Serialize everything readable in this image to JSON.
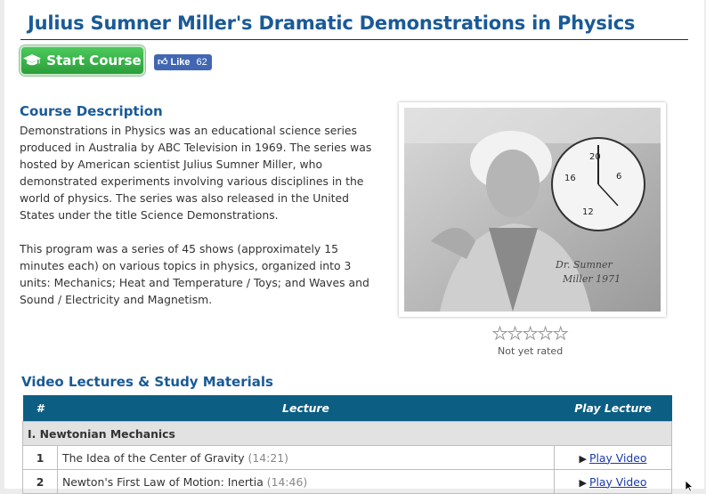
{
  "course": {
    "title": "Julius Sumner Miller's Dramatic Demonstrations in Physics",
    "start_label": "Start Course",
    "fb_like_label": "Like",
    "fb_like_count": "62"
  },
  "description": {
    "heading": "Course Description",
    "paragraphs": [
      "Demonstrations in Physics was an educational science series produced in Australia by ABC Television in 1969. The series was hosted by American scientist Julius Sumner Miller, who demonstrated experiments involving various disciplines in the world of physics. The series was also released in the United States under the title Science Demonstrations.",
      "This program was a series of 45 shows (approximately 15 minutes each) on various topics in physics, organized into 3 units: Mechanics; Heat and Temperature / Toys; and Waves and Sound / Electricity and Magnetism."
    ]
  },
  "rating": {
    "label": "Not yet rated",
    "stars_filled": 0,
    "stars_total": 5
  },
  "lectures": {
    "heading": "Video Lectures & Study Materials",
    "columns": {
      "num": "#",
      "lecture": "Lecture",
      "play": "Play Lecture"
    },
    "unit": "I. Newtonian Mechanics",
    "rows": [
      {
        "num": "1",
        "title": "The Idea of the Center of Gravity",
        "duration": "(14:21)",
        "play": "Play Video"
      },
      {
        "num": "2",
        "title": "Newton's First Law of Motion: Inertia",
        "duration": "(14:46)",
        "play": "Play Video"
      }
    ]
  },
  "colors": {
    "heading_blue": "#1a5a96",
    "table_header": "#0c5e83",
    "start_green": "#2b9e3a",
    "facebook_blue": "#4267b2"
  },
  "icons": [
    "graduation-cap-icon",
    "facebook-thumb-icon",
    "star-icon",
    "play-arrow-icon",
    "mouse-cursor-icon"
  ]
}
